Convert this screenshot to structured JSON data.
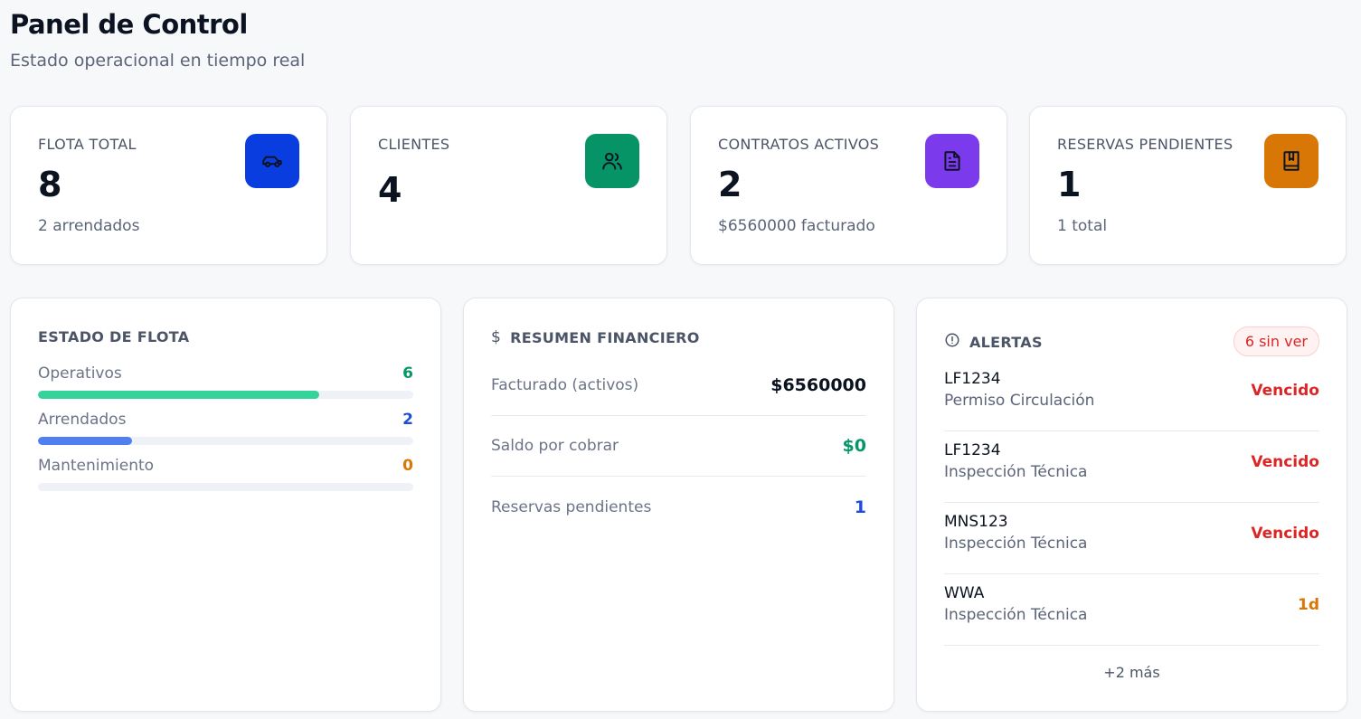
{
  "header": {
    "title": "Panel de Control",
    "subtitle": "Estado operacional en tiempo real"
  },
  "stats": [
    {
      "label": "FLOTA TOTAL",
      "value": "8",
      "sub": "2 arrendados",
      "icon": "car-icon",
      "color": "#0a3de0"
    },
    {
      "label": "CLIENTES",
      "value": "4",
      "sub": "",
      "icon": "users-icon",
      "color": "#069467"
    },
    {
      "label": "CONTRATOS ACTIVOS",
      "value": "2",
      "sub": "$6560000 facturado",
      "icon": "document-icon",
      "color": "#7c3aed"
    },
    {
      "label": "RESERVAS PENDIENTES",
      "value": "1",
      "sub": "1 total",
      "icon": "bookmark-book-icon",
      "color": "#d97706"
    }
  ],
  "fleet": {
    "title": "ESTADO DE FLOTA",
    "rows": [
      {
        "label": "Operativos",
        "count": "6",
        "fraction": 0.75,
        "color": "#34d399",
        "count_color": "#059669"
      },
      {
        "label": "Arrendados",
        "count": "2",
        "fraction": 0.25,
        "color": "#4f7ff0",
        "count_color": "#1d4ed8"
      },
      {
        "label": "Mantenimiento",
        "count": "0",
        "fraction": 0,
        "color": "#f59e0b",
        "count_color": "#d97706"
      }
    ]
  },
  "finance": {
    "title": "RESUMEN FINANCIERO",
    "icon": "dollar-icon",
    "rows": [
      {
        "label": "Facturado (activos)",
        "value": "$6560000",
        "color": "#0b1220"
      },
      {
        "label": "Saldo por cobrar",
        "value": "$0",
        "color": "#059669"
      },
      {
        "label": "Reservas pendientes",
        "value": "1",
        "color": "#1d4ed8"
      }
    ]
  },
  "alerts": {
    "title": "ALERTAS",
    "icon": "alert-circle-icon",
    "badge": "6 sin ver",
    "items": [
      {
        "code": "LF1234",
        "desc": "Permiso Circulación",
        "status": "Vencido",
        "color": "#dc2626"
      },
      {
        "code": "LF1234",
        "desc": "Inspección Técnica",
        "status": "Vencido",
        "color": "#dc2626"
      },
      {
        "code": "MNS123",
        "desc": "Inspección Técnica",
        "status": "Vencido",
        "color": "#dc2626"
      },
      {
        "code": "WWA",
        "desc": "Inspección Técnica",
        "status": "1d",
        "color": "#d97706"
      }
    ],
    "more": "+2 más"
  }
}
